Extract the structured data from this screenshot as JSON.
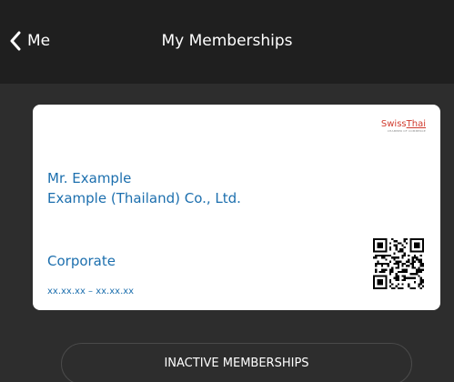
{
  "header": {
    "back_label": "Me",
    "title": "My Memberships"
  },
  "card": {
    "logo": {
      "word_swiss": "Swiss",
      "word_thai": "Thai",
      "subtitle": "CHAMBER OF COMMERCE"
    },
    "member_name": "Mr. Example",
    "company": "Example (Thailand) Co., Ltd.",
    "membership_type": "Corporate",
    "validity": "xx.xx.xx – xx.xx.xx"
  },
  "actions": {
    "inactive_label": "INACTIVE MEMBERSHIPS"
  },
  "colors": {
    "background": "#2d2d2d",
    "topbar": "#1f1f1f",
    "card": "#ffffff",
    "card_text": "#1c6fae",
    "logo_accent": "#d03a2d"
  }
}
